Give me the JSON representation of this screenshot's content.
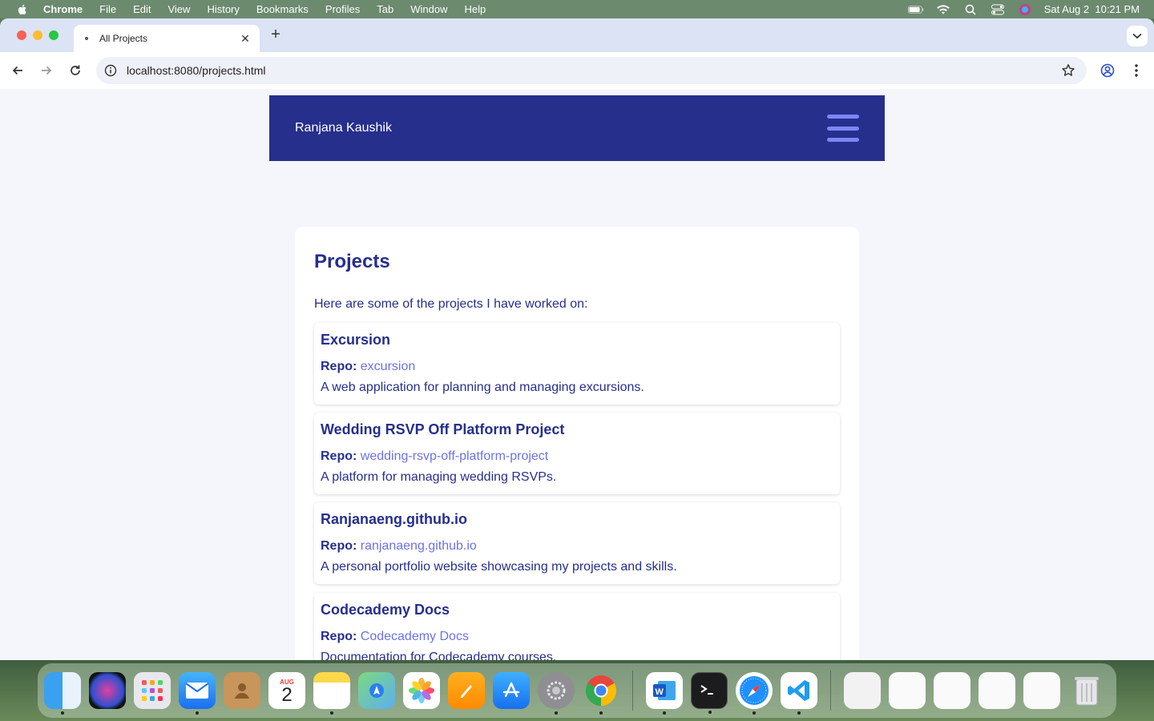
{
  "menubar": {
    "app": "Chrome",
    "items": [
      "File",
      "Edit",
      "View",
      "History",
      "Bookmarks",
      "Profiles",
      "Tab",
      "Window",
      "Help"
    ],
    "datetime": "Sat Aug 2  10:21 PM"
  },
  "browser": {
    "tab_title": "All Projects",
    "url": "localhost:8080/projects.html"
  },
  "site": {
    "name": "Ranjana Kaushik",
    "page_title": "Projects",
    "intro": "Here are some of the projects I have worked on:",
    "repo_label": "Repo:",
    "projects": [
      {
        "title": "Excursion",
        "repo": "excursion",
        "desc": "A web application for planning and managing excursions."
      },
      {
        "title": "Wedding RSVP Off Platform Project",
        "repo": "wedding-rsvp-off-platform-project",
        "desc": "A platform for managing wedding RSVPs."
      },
      {
        "title": "Ranjanaeng.github.io",
        "repo": "ranjanaeng.github.io",
        "desc": "A personal portfolio website showcasing my projects and skills."
      },
      {
        "title": "Codecademy Docs",
        "repo": "Codecademy Docs",
        "desc": "Documentation for Codecademy courses."
      }
    ]
  },
  "colors": {
    "header_bg": "#262f8c",
    "accent": "#7d86f5",
    "link": "#6b72e6"
  },
  "dock": {
    "apps": [
      "finder-icon",
      "siri-icon",
      "launchpad-icon",
      "mail-icon",
      "contacts-icon",
      "calendar-icon",
      "notes-icon",
      "maps-icon",
      "photos-icon",
      "pages-icon",
      "app-store-icon",
      "system-settings-icon",
      "chrome-icon",
      "word-icon",
      "terminal-icon",
      "safari-icon",
      "vscode-icon"
    ],
    "calendar_month": "AUG",
    "calendar_day": "2"
  }
}
